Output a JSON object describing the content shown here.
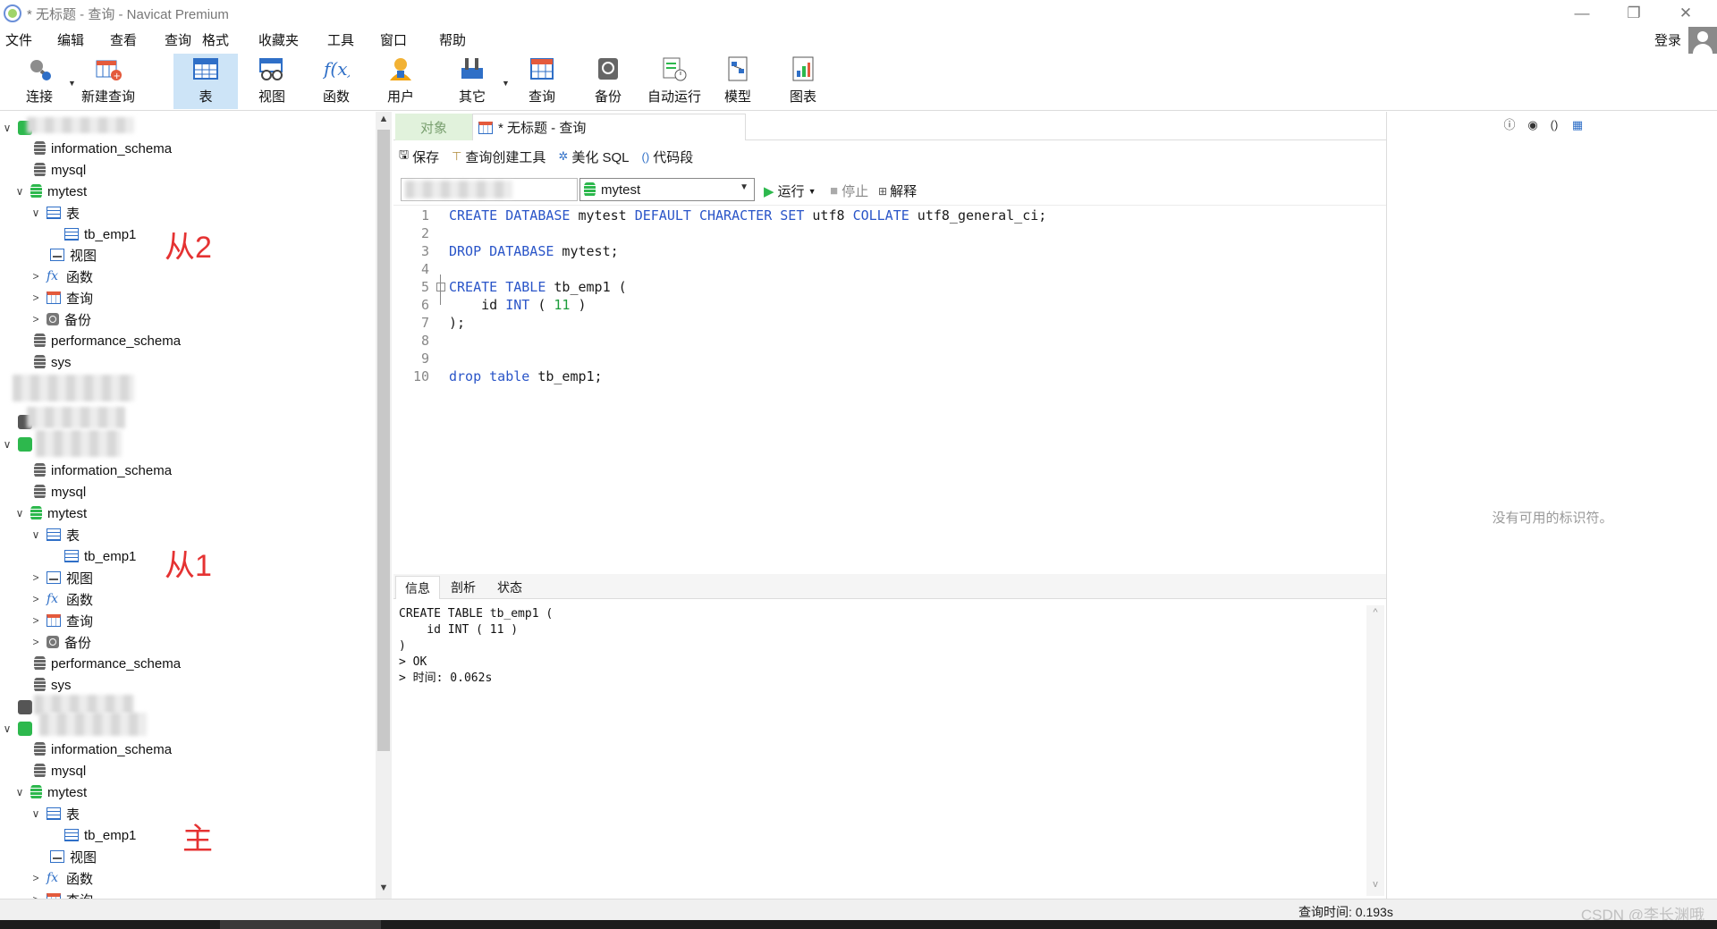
{
  "window": {
    "title": "* 无标题 - 查询 - Navicat Premium",
    "controls": {
      "minimize": "—",
      "restore": "❐",
      "close": "✕"
    }
  },
  "menu": {
    "items": [
      "文件",
      "编辑",
      "查看",
      "查询",
      "格式",
      "收藏夹",
      "工具",
      "窗口",
      "帮助"
    ],
    "login": "登录"
  },
  "toolbar": {
    "connect": "连接",
    "new_query": "新建查询",
    "table": "表",
    "view": "视图",
    "function": "函数",
    "user": "用户",
    "other": "其它",
    "query": "查询",
    "backup": "备份",
    "auto_run": "自动运行",
    "model": "模型",
    "chart": "图表"
  },
  "sidebar": {
    "groups": [
      {
        "schemas": [
          "information_schema",
          "mysql"
        ],
        "db": "mytest",
        "table_folder": "表",
        "table": "tb_emp1",
        "view": "视图",
        "function": "函数",
        "query": "查询",
        "backup": "备份",
        "more_schemas": [
          "performance_schema",
          "sys"
        ],
        "annotation": "从2"
      },
      {
        "schemas": [
          "information_schema",
          "mysql"
        ],
        "db": "mytest",
        "table_folder": "表",
        "table": "tb_emp1",
        "view": "视图",
        "function": "函数",
        "query": "查询",
        "backup": "备份",
        "more_schemas": [
          "performance_schema",
          "sys"
        ],
        "annotation": "从1"
      },
      {
        "schemas": [
          "information_schema",
          "mysql"
        ],
        "db": "mytest",
        "table_folder": "表",
        "table": "tb_emp1",
        "view": "视图",
        "function": "函数",
        "query": "查询",
        "annotation": "主"
      }
    ]
  },
  "tabs": {
    "objects": "对象",
    "query": "* 无标题 - 查询"
  },
  "editor_toolbar": {
    "save": "保存",
    "query_builder": "查询创建工具",
    "beautify": "美化 SQL",
    "snippet": "代码段"
  },
  "run_toolbar": {
    "database": "mytest",
    "run": "运行",
    "stop": "停止",
    "explain": "解释"
  },
  "editor": {
    "line_numbers": [
      "1",
      "2",
      "3",
      "4",
      "5",
      "6",
      "7",
      "8",
      "9",
      "10"
    ],
    "lines": {
      "l1": {
        "kw1": "CREATE DATABASE",
        "t1": " mytest ",
        "kw2": "DEFAULT CHARACTER SET",
        "t2": " utf8 ",
        "kw3": "COLLATE",
        "t3": " utf8_general_ci;"
      },
      "l3": {
        "kw1": "DROP DATABASE",
        "t1": " mytest;"
      },
      "l5": {
        "kw1": "CREATE TABLE",
        "t1": " tb_emp1 ("
      },
      "l6": {
        "t0": "    id ",
        "kw1": "INT",
        "t1": " ( ",
        "num": "11",
        "t2": " )"
      },
      "l7": {
        "t0": ");"
      },
      "l10": {
        "kw1": "drop",
        "t0": " ",
        "kw2": "table",
        "t1": " tb_emp1;"
      }
    }
  },
  "results": {
    "tabs": [
      "信息",
      "剖析",
      "状态"
    ],
    "lines": [
      "CREATE TABLE tb_emp1 (",
      "    id INT ( 11 )",
      ")",
      "> OK",
      "> 时间: 0.062s"
    ]
  },
  "right_panel": {
    "empty_text": "没有可用的标识符。"
  },
  "status": {
    "query_time": "查询时间: 0.193s",
    "watermark": "CSDN @李长渊哦"
  },
  "colors": {
    "keyword": "#2a55c8",
    "number": "#1b9c3a",
    "annotation": "#e53232",
    "db_active": "#2db84d",
    "tab_objects_bg": "#e1f2dc",
    "toolbar_active": "#cde4f7"
  }
}
